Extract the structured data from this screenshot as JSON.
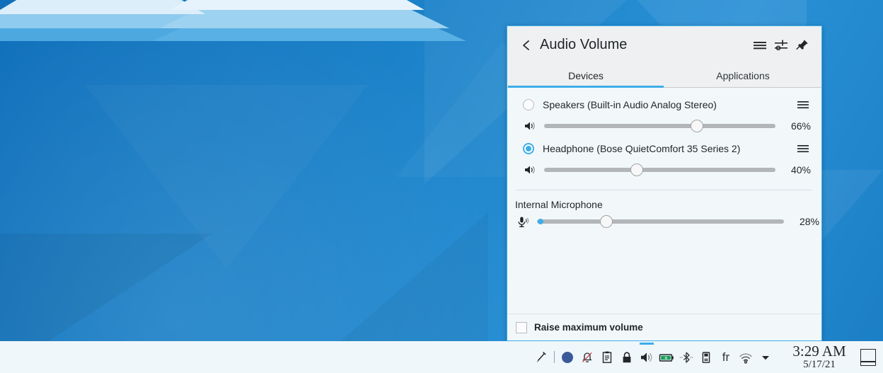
{
  "desktop": {
    "wallpaper_name": "plasma-geometric-blue-wallpaper",
    "colors": {
      "accent": "#3daee9",
      "panel_bg": "#eff0f1",
      "content_bg": "#f2f8fa",
      "taskbar_bg": "#eff7fb",
      "text": "#232629",
      "groove": "#b2b6b9"
    }
  },
  "applet": {
    "title": "Audio Volume",
    "back_icon": "chevron-left-icon",
    "header_actions": [
      {
        "name": "hamburger-menu-icon",
        "label": "Menu"
      },
      {
        "name": "audio-settings-icon",
        "label": "Configure Audio Volume"
      },
      {
        "name": "pin-icon",
        "label": "Keep Open"
      }
    ],
    "tabs": [
      {
        "label": "Devices",
        "active": true
      },
      {
        "label": "Applications",
        "active": false
      }
    ],
    "devices": [
      {
        "name": "Speakers (Built-in Audio Analog Stereo)",
        "selected": false,
        "volume_label": "66%",
        "volume_percent": 66,
        "volume_icon": "speaker-icon",
        "menu_icon": "hamburger-menu-icon",
        "has_peak_meter": false
      },
      {
        "name": "Headphone (Bose QuietComfort 35 Series 2)",
        "selected": true,
        "volume_label": "40%",
        "volume_percent": 40,
        "volume_icon": "speaker-icon",
        "menu_icon": "hamburger-menu-icon",
        "has_peak_meter": false
      }
    ],
    "capture_section": {
      "label": "Internal Microphone",
      "volume_label": "28%",
      "volume_percent": 28,
      "volume_icon": "microphone-icon",
      "has_peak_meter": true
    },
    "footer": {
      "raise_max_volume_label": "Raise maximum volume",
      "raise_max_volume_checked": false
    }
  },
  "taskbar": {
    "tray_icons": [
      {
        "name": "pen-tool-icon",
        "active": false
      },
      {
        "name": "blue-circle-status-icon",
        "active": false
      },
      {
        "name": "notifications-muted-icon",
        "active": false
      },
      {
        "name": "clipboard-icon",
        "active": false
      },
      {
        "name": "lock-icon",
        "active": false
      },
      {
        "name": "volume-icon",
        "active": true
      },
      {
        "name": "battery-charging-icon",
        "active": false
      },
      {
        "name": "bluetooth-inactive-icon",
        "active": false
      },
      {
        "name": "usb-device-icon",
        "active": false
      },
      {
        "name": "keyboard-layout-icon",
        "label": "fr",
        "active": false
      },
      {
        "name": "wifi-icon",
        "active": false
      },
      {
        "name": "show-hidden-icons-icon",
        "active": false
      }
    ],
    "clock": {
      "time": "3:29 AM",
      "date": "5/17/21"
    },
    "show_desktop_icon": "show-desktop-icon"
  }
}
